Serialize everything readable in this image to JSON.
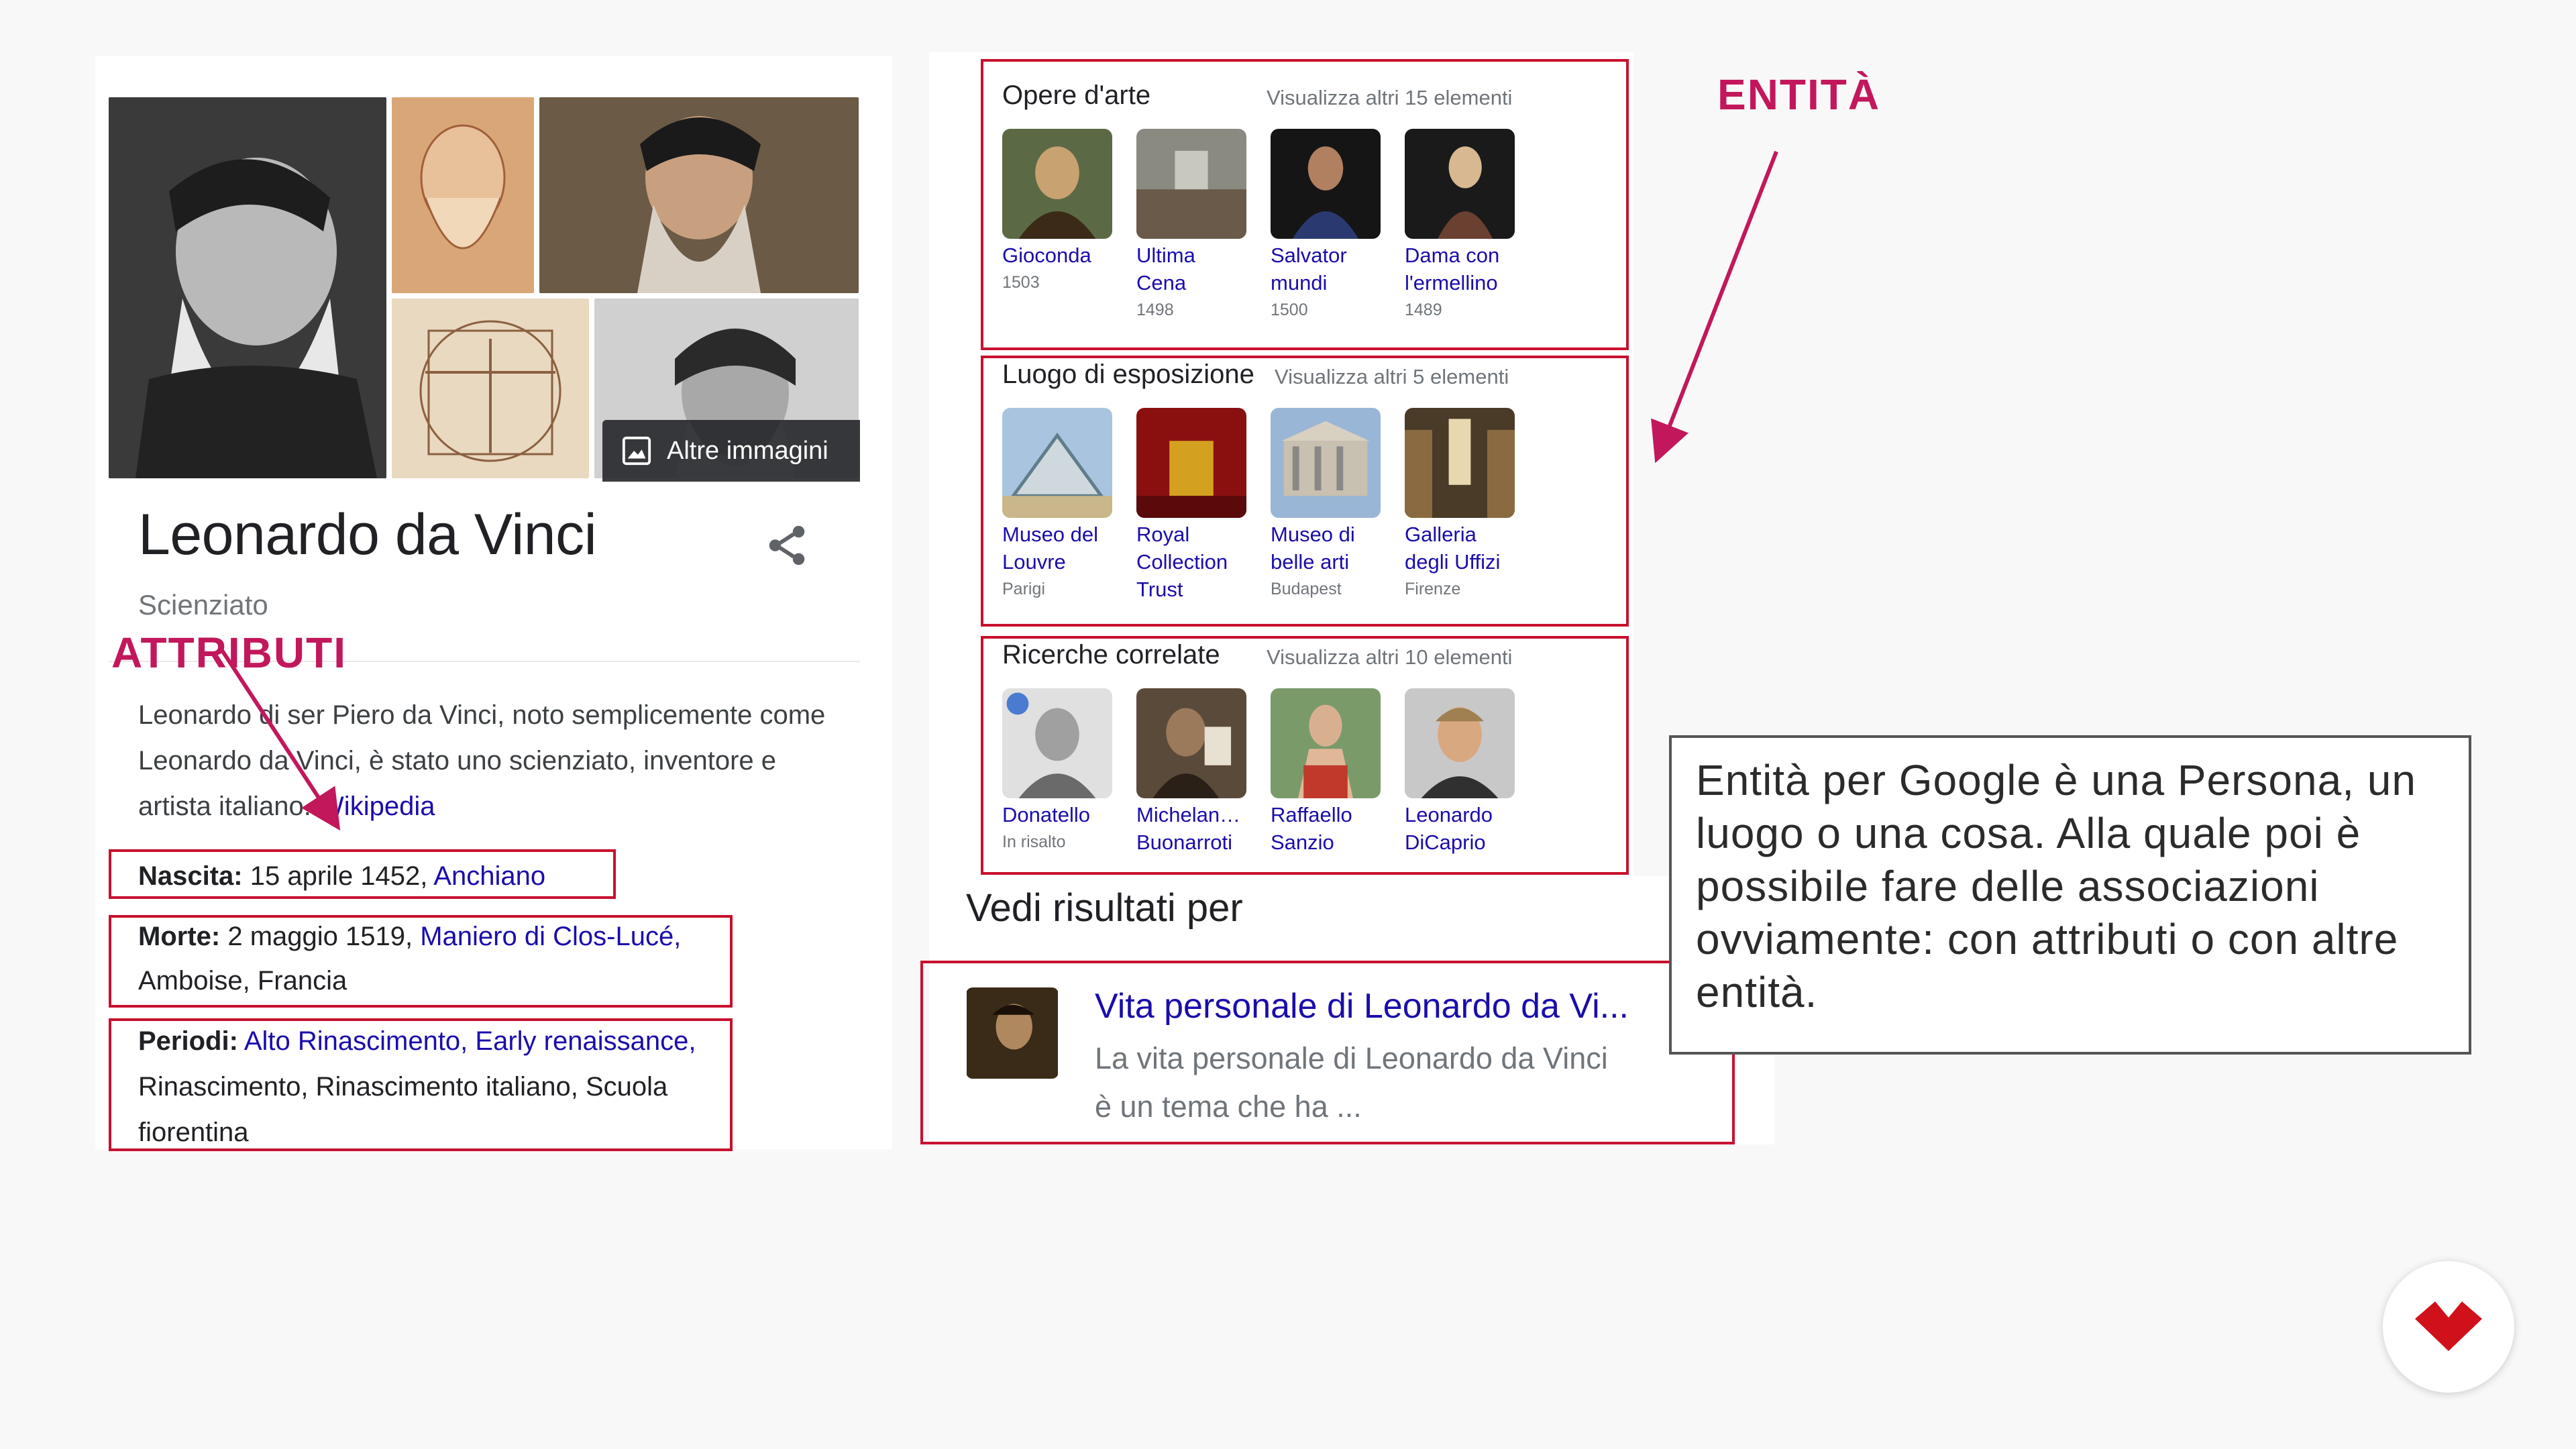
{
  "knowledge_panel": {
    "more_images_label": "Altre immagini",
    "title": "Leonardo da Vinci",
    "subtitle": "Scienziato",
    "description": "Leonardo di ser Piero da Vinci, noto semplicemente come Leonardo da Vinci, è stato uno scienziato, inventore e artista italiano.",
    "description_link": "Wikipedia",
    "birth": {
      "label": "Nascita:",
      "text": "15 aprile 1452,",
      "link": "Anchiano"
    },
    "death": {
      "label": "Morte:",
      "text": "2 maggio 1519,",
      "link1": "Maniero di Clos-Lucé,",
      "link2": "Amboise, Francia"
    },
    "periods": {
      "label": "Periodi:",
      "line1": "Alto Rinascimento, Early renaissance,",
      "line2": "Rinascimento, Rinascimento italiano, Scuola",
      "line3": "fiorentina"
    }
  },
  "sections": {
    "artworks": {
      "title": "Opere d'arte",
      "more": "Visualizza altri 15 elementi",
      "items": [
        {
          "line1": "Gioconda",
          "line2": "",
          "sub": "1503"
        },
        {
          "line1": "Ultima",
          "line2": "Cena",
          "sub": "1498"
        },
        {
          "line1": "Salvator",
          "line2": "mundi",
          "sub": "1500"
        },
        {
          "line1": "Dama con",
          "line2": "l'ermellino",
          "sub": "1489"
        }
      ]
    },
    "locations": {
      "title": "Luogo di esposizione",
      "more": "Visualizza altri 5 elementi",
      "items": [
        {
          "line1": "Museo del",
          "line2": "Louvre",
          "line3": "",
          "sub": "Parigi"
        },
        {
          "line1": "Royal",
          "line2": "Collection",
          "line3": "Trust",
          "sub": ""
        },
        {
          "line1": "Museo di",
          "line2": "belle arti",
          "line3": "",
          "sub": "Budapest"
        },
        {
          "line1": "Galleria",
          "line2": "degli Uffizi",
          "line3": "",
          "sub": "Firenze"
        }
      ]
    },
    "related": {
      "title": "Ricerche correlate",
      "more": "Visualizza altri 10 elementi",
      "items": [
        {
          "line1": "Donatello",
          "sub": "In risalto"
        },
        {
          "line1": "Michelan…",
          "line2": "Buonarroti"
        },
        {
          "line1": "Raffaello",
          "line2": "Sanzio"
        },
        {
          "line1": "Leonardo",
          "line2": "DiCaprio"
        }
      ]
    }
  },
  "see_results": {
    "title": "Vedi risultati per",
    "result_title": "Vita personale di Leonardo da Vi...",
    "result_desc_line1": "La vita personale di Leonardo da Vinci",
    "result_desc_line2": "è un tema che ha ..."
  },
  "annotations": {
    "attributes_label": "ATTRIBUTI",
    "entities_label": "ENTITÀ",
    "note": "Entità per Google è una Persona, un luogo o una cosa. Alla quale poi è possibile fare delle associazioni ovviamente: con attributi o con altre entità.",
    "accent_color": "#c2185b"
  },
  "icons": [
    "image-icon",
    "share-icon",
    "brand-logo-icon",
    "trending-icon"
  ]
}
